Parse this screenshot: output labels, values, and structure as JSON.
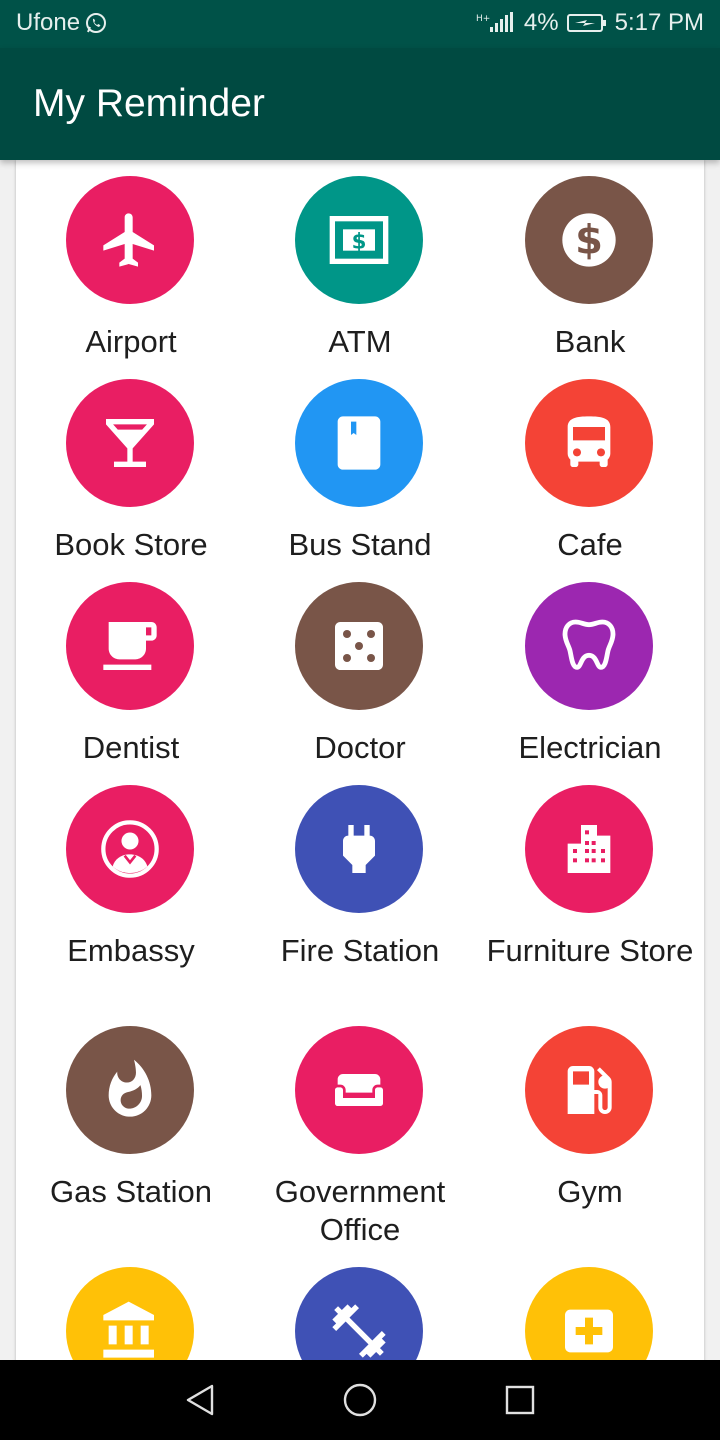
{
  "status_bar": {
    "carrier": "Ufone",
    "network": "H+",
    "battery": "4%",
    "time": "5:17 PM"
  },
  "app_bar": {
    "title": "My Reminder"
  },
  "colors": {
    "status_bar": "#005248",
    "app_bar": "#004a41",
    "pink": "#e91e63",
    "teal": "#009688",
    "brown": "#795548",
    "blue": "#2196f3",
    "red": "#f44336",
    "purple": "#9c27b0",
    "indigo": "#3f51b5",
    "amber": "#ffc107"
  },
  "categories": [
    {
      "label": "Airport",
      "icon": "airplane-icon",
      "color": "#e91e63"
    },
    {
      "label": "ATM",
      "icon": "atm-icon",
      "color": "#009688"
    },
    {
      "label": "Bank",
      "icon": "dollar-icon",
      "color": "#795548"
    },
    {
      "label": "Book Store",
      "icon": "cocktail-icon",
      "color": "#e91e63"
    },
    {
      "label": "Bus Stand",
      "icon": "book-icon",
      "color": "#2196f3"
    },
    {
      "label": "Cafe",
      "icon": "bus-icon",
      "color": "#f44336"
    },
    {
      "label": "Dentist",
      "icon": "coffee-cup-icon",
      "color": "#e91e63"
    },
    {
      "label": "Doctor",
      "icon": "dice-icon",
      "color": "#795548"
    },
    {
      "label": "Electrician",
      "icon": "tooth-icon",
      "color": "#9c27b0"
    },
    {
      "label": "Embassy",
      "icon": "doctor-avatar-icon",
      "color": "#e91e63"
    },
    {
      "label": "Fire Station",
      "icon": "plug-icon",
      "color": "#3f51b5"
    },
    {
      "label": "Furniture Store",
      "icon": "building-icon",
      "color": "#e91e63"
    },
    {
      "label": "Gas Station",
      "icon": "flame-icon",
      "color": "#795548"
    },
    {
      "label": "Government Office",
      "icon": "sofa-icon",
      "color": "#e91e63"
    },
    {
      "label": "Gym",
      "icon": "fuel-pump-icon",
      "color": "#f44336"
    },
    {
      "label": "",
      "icon": "bank-building-icon",
      "color": "#ffc107"
    },
    {
      "label": "",
      "icon": "dumbbell-icon",
      "color": "#3f51b5"
    },
    {
      "label": "",
      "icon": "first-aid-icon",
      "color": "#ffc107"
    }
  ]
}
